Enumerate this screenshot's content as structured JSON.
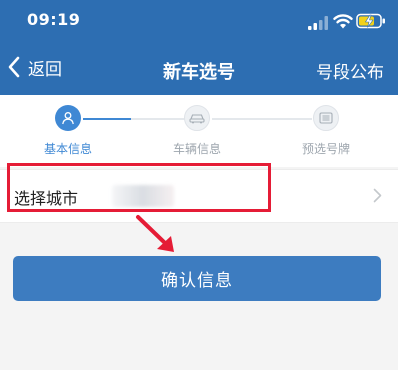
{
  "status_bar": {
    "time": "09:19"
  },
  "nav": {
    "back_label": "返回",
    "title": "新车选号",
    "right_label": "号段公布"
  },
  "steps": [
    {
      "label": "基本信息",
      "icon": "user-icon",
      "state": "active"
    },
    {
      "label": "车辆信息",
      "icon": "car-icon",
      "state": "inactive"
    },
    {
      "label": "预选号牌",
      "icon": "license-plate-icon",
      "state": "inactive"
    }
  ],
  "city_row": {
    "label": "选择城市",
    "value": ""
  },
  "confirm_button": {
    "label": "确认信息"
  },
  "colors": {
    "header": "#2d6eb2",
    "accent": "#3f88d4",
    "button": "#3d7cc0",
    "highlight": "#e51c36"
  }
}
